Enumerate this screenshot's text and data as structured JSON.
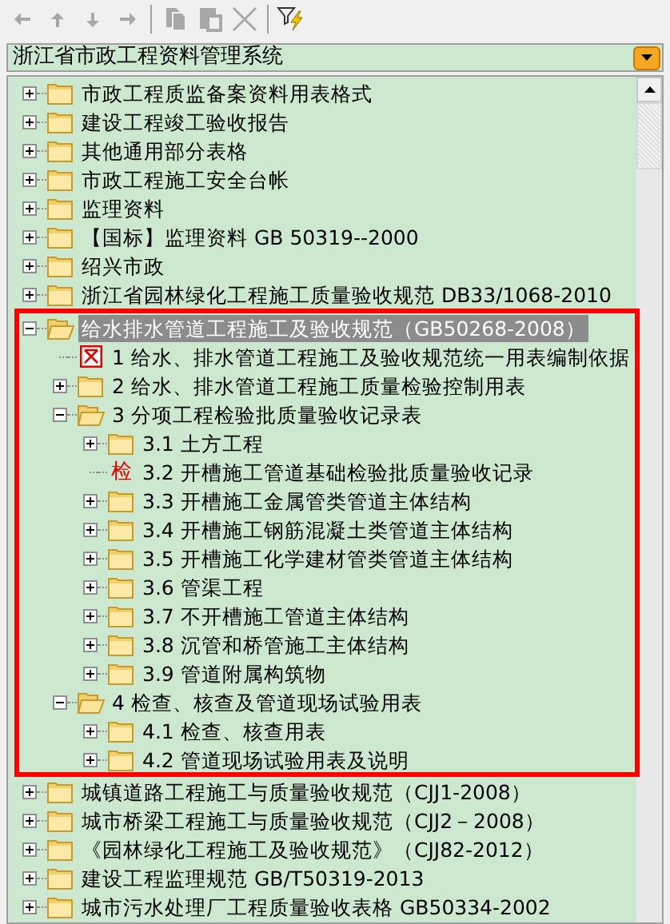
{
  "toolbar": [
    {
      "kind": "back",
      "disabled": true
    },
    {
      "kind": "up",
      "disabled": true
    },
    {
      "kind": "down",
      "disabled": true
    },
    {
      "kind": "forward",
      "disabled": true
    },
    {
      "kind": "copy",
      "disabled": true
    },
    {
      "kind": "paste",
      "disabled": true
    },
    {
      "kind": "delete",
      "disabled": true
    },
    {
      "kind": "filter",
      "disabled": false
    }
  ],
  "system_select": {
    "value": "浙江省市政工程资料管理系统"
  },
  "tree": [
    {
      "label": "市政工程质监备案资料用表格式",
      "kind": "folder",
      "expanded": false,
      "selected": false
    },
    {
      "label": "建设工程竣工验收报告",
      "kind": "folder",
      "expanded": false,
      "selected": false
    },
    {
      "label": "其他通用部分表格",
      "kind": "folder",
      "expanded": false,
      "selected": false
    },
    {
      "label": "市政工程施工安全台帐",
      "kind": "folder",
      "expanded": false,
      "selected": false
    },
    {
      "label": "监理资料",
      "kind": "folder",
      "expanded": false,
      "selected": false
    },
    {
      "label": "【国标】监理资料 GB 50319--2000",
      "kind": "folder",
      "expanded": false,
      "selected": false
    },
    {
      "label": "绍兴市政",
      "kind": "folder",
      "expanded": false,
      "selected": false
    },
    {
      "label": "浙江省园林绿化工程施工质量验收规范 DB33/1068-2010",
      "kind": "folder",
      "expanded": false,
      "selected": false
    },
    {
      "label": "给水排水管道工程施工及验收规范（GB50268-2008）",
      "kind": "folder",
      "expanded": true,
      "selected": true,
      "highlighted": true,
      "children": [
        {
          "label": "1 给水、排水管道工程施工及验收规范统一用表编制依据",
          "kind": "document",
          "selected": false
        },
        {
          "label": "2 给水、排水管道工程施工质量检验控制用表",
          "kind": "folder",
          "expanded": false,
          "selected": false
        },
        {
          "label": "3 分项工程检验批质量验收记录表",
          "kind": "folder",
          "expanded": true,
          "selected": false,
          "children": [
            {
              "label": "3.1 土方工程",
              "kind": "folder",
              "expanded": false,
              "selected": false
            },
            {
              "label": "3.2 开槽施工管道基础检验批质量验收记录",
              "kind": "mark",
              "icon_text": "检",
              "selected": false
            },
            {
              "label": "3.3 开槽施工金属管类管道主体结构",
              "kind": "folder",
              "expanded": false,
              "selected": false
            },
            {
              "label": "3.4 开槽施工钢筋混凝土类管道主体结构",
              "kind": "folder",
              "expanded": false,
              "selected": false
            },
            {
              "label": "3.5 开槽施工化学建材管类管道主体结构",
              "kind": "folder",
              "expanded": false,
              "selected": false
            },
            {
              "label": "3.6 管渠工程",
              "kind": "folder",
              "expanded": false,
              "selected": false
            },
            {
              "label": "3.7 不开槽施工管道主体结构",
              "kind": "folder",
              "expanded": false,
              "selected": false
            },
            {
              "label": "3.8 沉管和桥管施工主体结构",
              "kind": "folder",
              "expanded": false,
              "selected": false
            },
            {
              "label": "3.9 管道附属构筑物",
              "kind": "folder",
              "expanded": false,
              "selected": false
            }
          ]
        },
        {
          "label": "4 检查、核查及管道现场试验用表",
          "kind": "folder",
          "expanded": true,
          "selected": false,
          "children": [
            {
              "label": "4.1 检查、核查用表",
              "kind": "folder",
              "expanded": false,
              "selected": false
            },
            {
              "label": "4.2 管道现场试验用表及说明",
              "kind": "folder",
              "expanded": false,
              "selected": false
            }
          ]
        }
      ]
    },
    {
      "label": "城镇道路工程施工与质量验收规范（CJJ1-2008）",
      "kind": "folder",
      "expanded": false,
      "selected": false
    },
    {
      "label": "城市桥梁工程施工与质量验收规范（CJJ2－2008）",
      "kind": "folder",
      "expanded": false,
      "selected": false
    },
    {
      "label": "《园林绿化工程施工及验收规范》（CJJ82-2012）",
      "kind": "folder",
      "expanded": false,
      "selected": false
    },
    {
      "label": "建设工程监理规范 GB/T50319-2013",
      "kind": "folder",
      "expanded": false,
      "selected": false
    },
    {
      "label": "城市污水处理厂工程质量验收表格 GB50334-2002",
      "kind": "folder",
      "expanded": false,
      "selected": false
    }
  ]
}
